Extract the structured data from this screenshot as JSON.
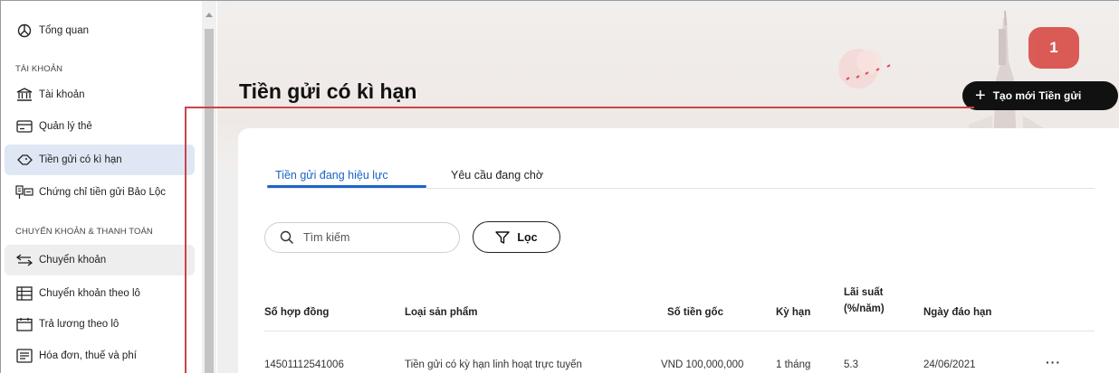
{
  "sidebar": {
    "overview": "Tổng quan",
    "section_account": "TÀI KHOẢN",
    "accounts": "Tài khoản",
    "cards": "Quản lý thẻ",
    "term_deposit": "Tiền gửi có kì hạn",
    "certificate": "Chứng chỉ tiền gửi Bảo Lộc",
    "section_transfer": "CHUYỂN KHOẢN & THANH TOÁN",
    "transfer": "Chuyển khoản",
    "batch_transfer": "Chuyển khoản theo lô",
    "payroll": "Trả lương theo lô",
    "bills": "Hóa đơn, thuế và phí"
  },
  "header": {
    "title": "Tiền gửi có kì hạn",
    "create_button": "Tạo mới Tiền gửi",
    "step_badge": "1"
  },
  "tabs": {
    "active": "Tiền gửi đang hiệu lực",
    "pending": "Yêu cầu đang chờ"
  },
  "search": {
    "placeholder": "Tìm kiếm"
  },
  "filter": {
    "label": "Lọc"
  },
  "table": {
    "columns": {
      "contract": "Số hợp đồng",
      "product": "Loại sản phẩm",
      "principal": "Số tiền gốc",
      "term": "Kỳ hạn",
      "rate_line1": "Lãi suất",
      "rate_line2": "(%/năm)",
      "maturity": "Ngày đáo hạn"
    },
    "rows": [
      {
        "contract": "14501112541006",
        "product": "Tiền gửi có kỳ hạn linh hoạt trực tuyến",
        "principal": "VND 100,000,000",
        "term": "1 tháng",
        "rate": "5.3",
        "maturity": "24/06/2021",
        "more": "···"
      }
    ]
  },
  "colors": {
    "accent_blue": "#1b64c8",
    "annotation_red": "#c9444a",
    "badge_red": "#d9534f",
    "active_item_bg": "#dfe7f4"
  }
}
